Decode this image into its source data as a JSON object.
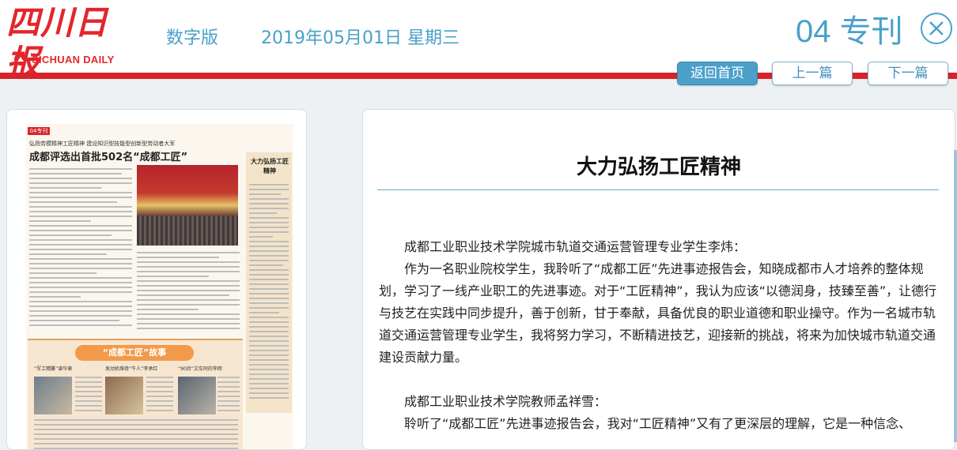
{
  "header": {
    "logo_cn": "四川日报",
    "logo_en": "SICHUAN DAILY",
    "edition": "数字版",
    "date": "2019年05月01日 星期三",
    "page_label": "04 专刊",
    "close_icon": "close-circle-icon",
    "home_button": "返回首页",
    "prev_button": "上一篇",
    "next_button": "下一篇"
  },
  "thumbnail": {
    "page_no": "04专刊",
    "kicker": "弘扬劳模精神工匠精神 建设知识型技能型创新型劳动者大军",
    "headline": "成都评选出首批502名“成都工匠”",
    "sidebar_title": "大力弘扬工匠精神",
    "story_title": "“成都工匠”故事",
    "story_captions": [
      "“军工精雕”谱华章",
      "发动机维修“牛人”李承红",
      "“90后”文车同的李辉"
    ]
  },
  "article": {
    "title": "大力弘扬工匠精神",
    "paragraphs": [
      "成都工业职业技术学院城市轨道交通运营管理专业学生李炜：",
      "作为一名职业院校学生，我聆听了“成都工匠”先进事迹报告会，知晓成都市人才培养的整体规划，学习了一线产业职工的先进事迹。对于“工匠精神”，我认为应该“以德润身，技臻至善”，让德行与技艺在实践中同步提升，善于创新，甘于奉献，具备优良的职业道德和职业操守。作为一名城市轨道交通运营管理专业学生，我将努力学习，不断精进技艺，迎接新的挑战，将来为加快城市轨道交通建设贡献力量。",
      "成都工业职业技术学院教师孟祥雪：",
      "聆听了“成都工匠”先进事迹报告会，我对“工匠精神”又有了更深层的理解，它是一种信念、"
    ]
  },
  "colors": {
    "brand_red": "#d8232a",
    "accent_blue": "#4aa0c9"
  }
}
